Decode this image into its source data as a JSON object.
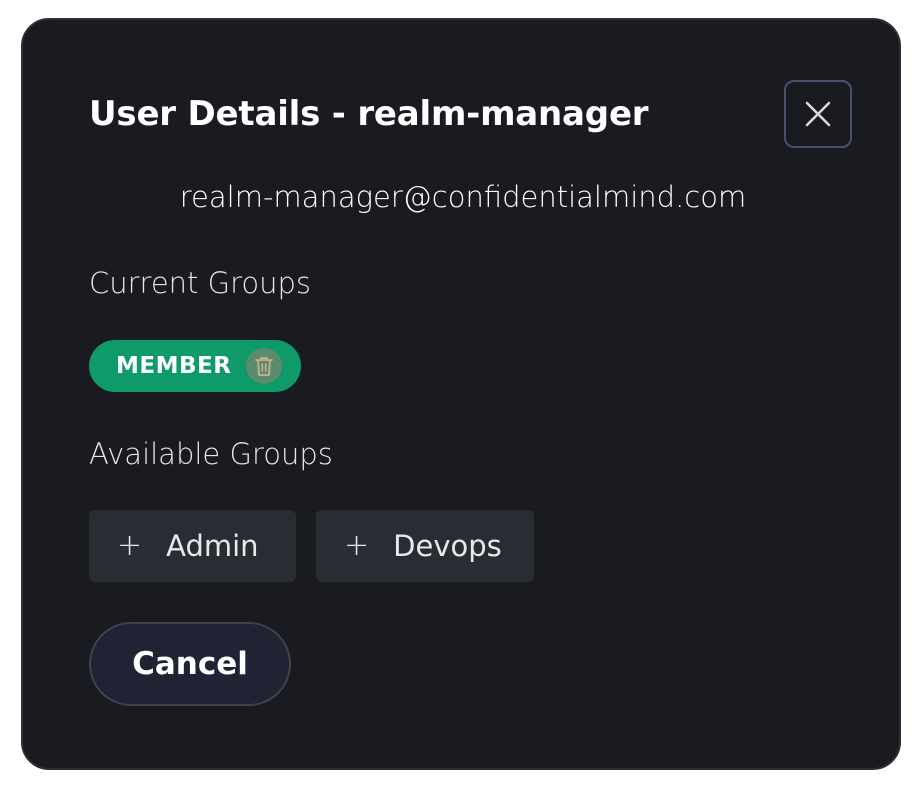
{
  "dialog": {
    "title": "User Details - realm-manager",
    "email": "realm-manager@confidentialmind.com",
    "close_icon": "close-icon"
  },
  "current_groups": {
    "label": "Current Groups",
    "items": [
      {
        "name": "MEMBER",
        "action_icon": "trash-icon"
      }
    ]
  },
  "available_groups": {
    "label": "Available Groups",
    "items": [
      {
        "icon": "+",
        "name": "Admin"
      },
      {
        "icon": "+",
        "name": "Devops"
      }
    ]
  },
  "actions": {
    "cancel_label": "Cancel"
  },
  "colors": {
    "background": "#1a1b21",
    "chip": "#0f9a6a",
    "group_button": "#2a2c33",
    "close_border": "#49506b"
  }
}
